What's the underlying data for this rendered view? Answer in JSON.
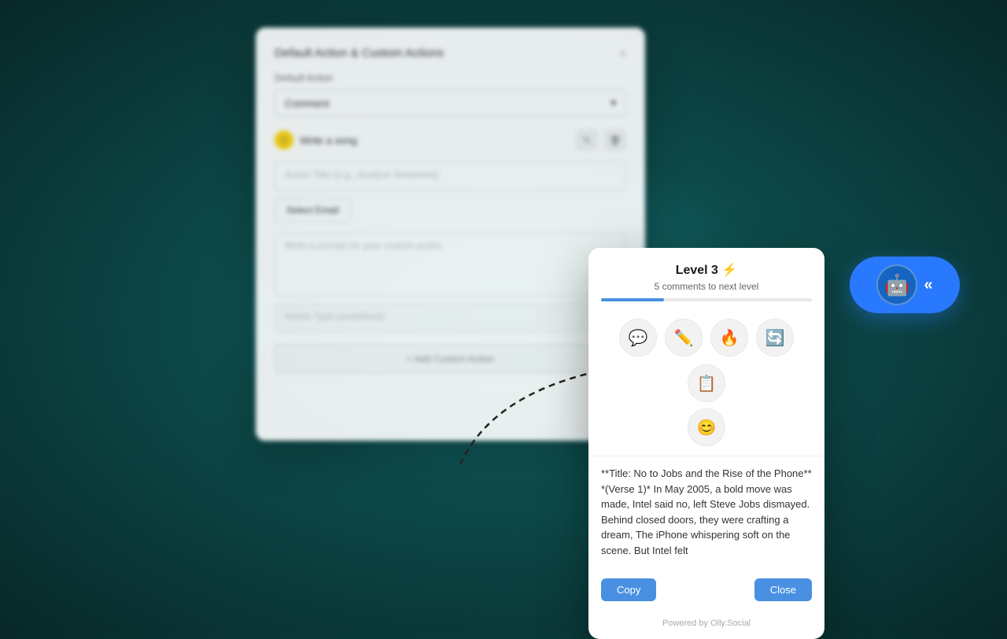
{
  "bg_modal": {
    "title": "Default Action & Custom Actions",
    "close_label": "×",
    "default_action_label": "Default Action",
    "select_value": "Comment",
    "custom_action_emoji": "🙂",
    "custom_action_text": "Write a song",
    "action_title_placeholder": "Action Title (e.g., Analyze Sentiment)",
    "select_email_label": "Select Email",
    "prompt_placeholder": "Write a prompt for your custom action",
    "action_type_placeholder": "Action Type (undefined)",
    "add_custom_action_label": "+ Add Custom Action"
  },
  "fg_panel": {
    "title": "Level 3 ⚡",
    "subtitle": "5 comments to next level",
    "progress_percent": 30,
    "icons": [
      "💬",
      "✏️",
      "🔥",
      "🔄",
      "📋"
    ],
    "second_row_icons": [
      "😊"
    ],
    "text_content": "**Title: No to Jobs and the Rise of the Phone** *(Verse 1)* In May 2005, a bold move was made, Intel said no, left Steve Jobs dismayed. Behind closed doors, they were crafting a dream, The iPhone whispering soft on the scene. But Intel felt",
    "copy_button": "Copy",
    "close_button": "Close",
    "footer": "Powered by Olly.Social"
  },
  "robot_widget": {
    "icon": "🤖",
    "chevron": "«"
  }
}
